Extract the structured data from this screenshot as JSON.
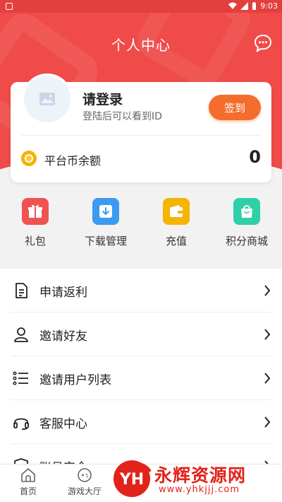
{
  "status_bar": {
    "time": "9:03"
  },
  "header": {
    "title": "个人中心",
    "message_icon": "chat-bubble-icon"
  },
  "user_card": {
    "login_title": "请登录",
    "login_subtitle": "登陆后可以看到ID",
    "signin_label": "签到",
    "balance_label": "平台币余额",
    "balance_value": "0"
  },
  "quick_actions": [
    {
      "label": "礼包",
      "icon": "gift-icon",
      "color": "#ef5350"
    },
    {
      "label": "下载管理",
      "icon": "download-icon",
      "color": "#3a9bf0"
    },
    {
      "label": "充值",
      "icon": "wallet-icon",
      "color": "#f5b400"
    },
    {
      "label": "积分商城",
      "icon": "shopping-bag-icon",
      "color": "#2fd0a8"
    }
  ],
  "menu": [
    {
      "label": "申请返利",
      "icon": "document-icon"
    },
    {
      "label": "邀请好友",
      "icon": "person-icon"
    },
    {
      "label": "邀请用户列表",
      "icon": "list-icon"
    },
    {
      "label": "客服中心",
      "icon": "headset-icon"
    },
    {
      "label": "账号安全",
      "icon": "shield-icon"
    }
  ],
  "tab_bar": [
    {
      "label": "首页",
      "icon": "home-icon"
    },
    {
      "label": "游戏大厅",
      "icon": "gamepad-icon"
    }
  ],
  "watermark": {
    "text": "永辉资源网",
    "url": "www.yhkjjj.com"
  }
}
